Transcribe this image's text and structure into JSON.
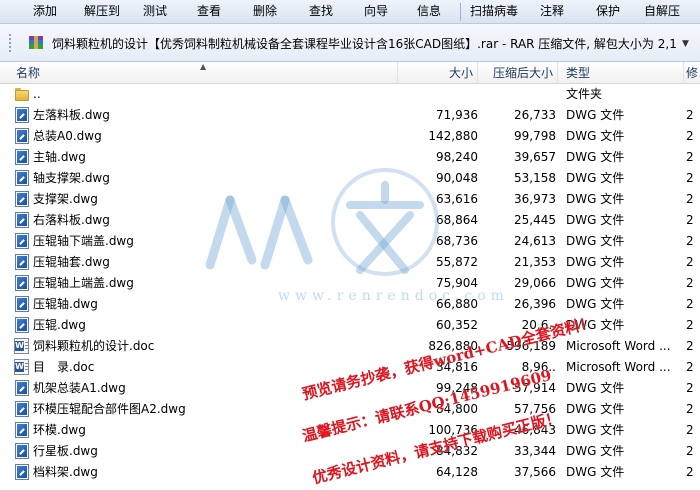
{
  "toolbar": {
    "buttons": [
      "添加",
      "解压到",
      "测试",
      "查看",
      "删除",
      "查找",
      "向导",
      "信息",
      "扫描病毒",
      "注释",
      "保护",
      "自解压"
    ]
  },
  "address": {
    "text": "饲料颗粒机的设计【优秀饲料制粒机械设备全套课程毕业设计含16张CAD图纸】.rar - RAR 压缩文件, 解包大小为 2,1"
  },
  "columns": {
    "name": "名称",
    "size": "大小",
    "packed": "压缩后大小",
    "type": "类型",
    "modified": "修"
  },
  "files": [
    {
      "icon": "folder",
      "name": "..",
      "size": "",
      "packed": "",
      "type": "文件夹",
      "mod": ""
    },
    {
      "icon": "dwg",
      "name": "左落料板.dwg",
      "size": "71,936",
      "packed": "26,733",
      "type": "DWG 文件",
      "mod": "2"
    },
    {
      "icon": "dwg",
      "name": "总装A0.dwg",
      "size": "142,880",
      "packed": "99,798",
      "type": "DWG 文件",
      "mod": "2"
    },
    {
      "icon": "dwg",
      "name": "主轴.dwg",
      "size": "98,240",
      "packed": "39,657",
      "type": "DWG 文件",
      "mod": "2"
    },
    {
      "icon": "dwg",
      "name": "轴支撑架.dwg",
      "size": "90,048",
      "packed": "53,158",
      "type": "DWG 文件",
      "mod": "2"
    },
    {
      "icon": "dwg",
      "name": "支撑架.dwg",
      "size": "63,616",
      "packed": "36,973",
      "type": "DWG 文件",
      "mod": "2"
    },
    {
      "icon": "dwg",
      "name": "右落料板.dwg",
      "size": "68,864",
      "packed": "25,445",
      "type": "DWG 文件",
      "mod": "2"
    },
    {
      "icon": "dwg",
      "name": "压辊轴下端盖.dwg",
      "size": "68,736",
      "packed": "24,613",
      "type": "DWG 文件",
      "mod": "2"
    },
    {
      "icon": "dwg",
      "name": "压辊轴套.dwg",
      "size": "55,872",
      "packed": "21,353",
      "type": "DWG 文件",
      "mod": "2"
    },
    {
      "icon": "dwg",
      "name": "压辊轴上端盖.dwg",
      "size": "75,904",
      "packed": "29,066",
      "type": "DWG 文件",
      "mod": "2"
    },
    {
      "icon": "dwg",
      "name": "压辊轴.dwg",
      "size": "66,880",
      "packed": "26,396",
      "type": "DWG 文件",
      "mod": "2"
    },
    {
      "icon": "dwg",
      "name": "压辊.dwg",
      "size": "60,352",
      "packed": "20,6..",
      "type": "DWG 文件",
      "mod": "2"
    },
    {
      "icon": "doc",
      "name": "饲料颗粒机的设计.doc",
      "size": "826,880",
      "packed": "596,189",
      "type": "Microsoft Word ...",
      "mod": "2"
    },
    {
      "icon": "doc",
      "name": "目　录.doc",
      "size": "34,816",
      "packed": "8,96..",
      "type": "Microsoft Word ...",
      "mod": "2"
    },
    {
      "icon": "dwg",
      "name": "机架总装A1.dwg",
      "size": "99,248",
      "packed": "57,914",
      "type": "DWG 文件",
      "mod": "2"
    },
    {
      "icon": "dwg",
      "name": "环模压辊配合部件图A2.dwg",
      "size": "84,800",
      "packed": "57,756",
      "type": "DWG 文件",
      "mod": "2"
    },
    {
      "icon": "dwg",
      "name": "环模.dwg",
      "size": "100,736",
      "packed": "46,843",
      "type": "DWG 文件",
      "mod": "2"
    },
    {
      "icon": "dwg",
      "name": "行星板.dwg",
      "size": "84,832",
      "packed": "33,344",
      "type": "DWG 文件",
      "mod": "2"
    },
    {
      "icon": "dwg",
      "name": "档料架.dwg",
      "size": "64,128",
      "packed": "37,566",
      "type": "DWG 文件",
      "mod": "2"
    }
  ],
  "watermark": {
    "url": "www.renrendoc.com"
  },
  "promo": {
    "line1": "预览请务抄袭，获得word+CAD全套资料！",
    "line2": "温馨提示：请联系QQ:1459919609",
    "line3": "优秀设计资料，请支持下载购买正版！"
  },
  "colors": {
    "promo": "#e0141e",
    "watermark": "#7aaad7"
  }
}
